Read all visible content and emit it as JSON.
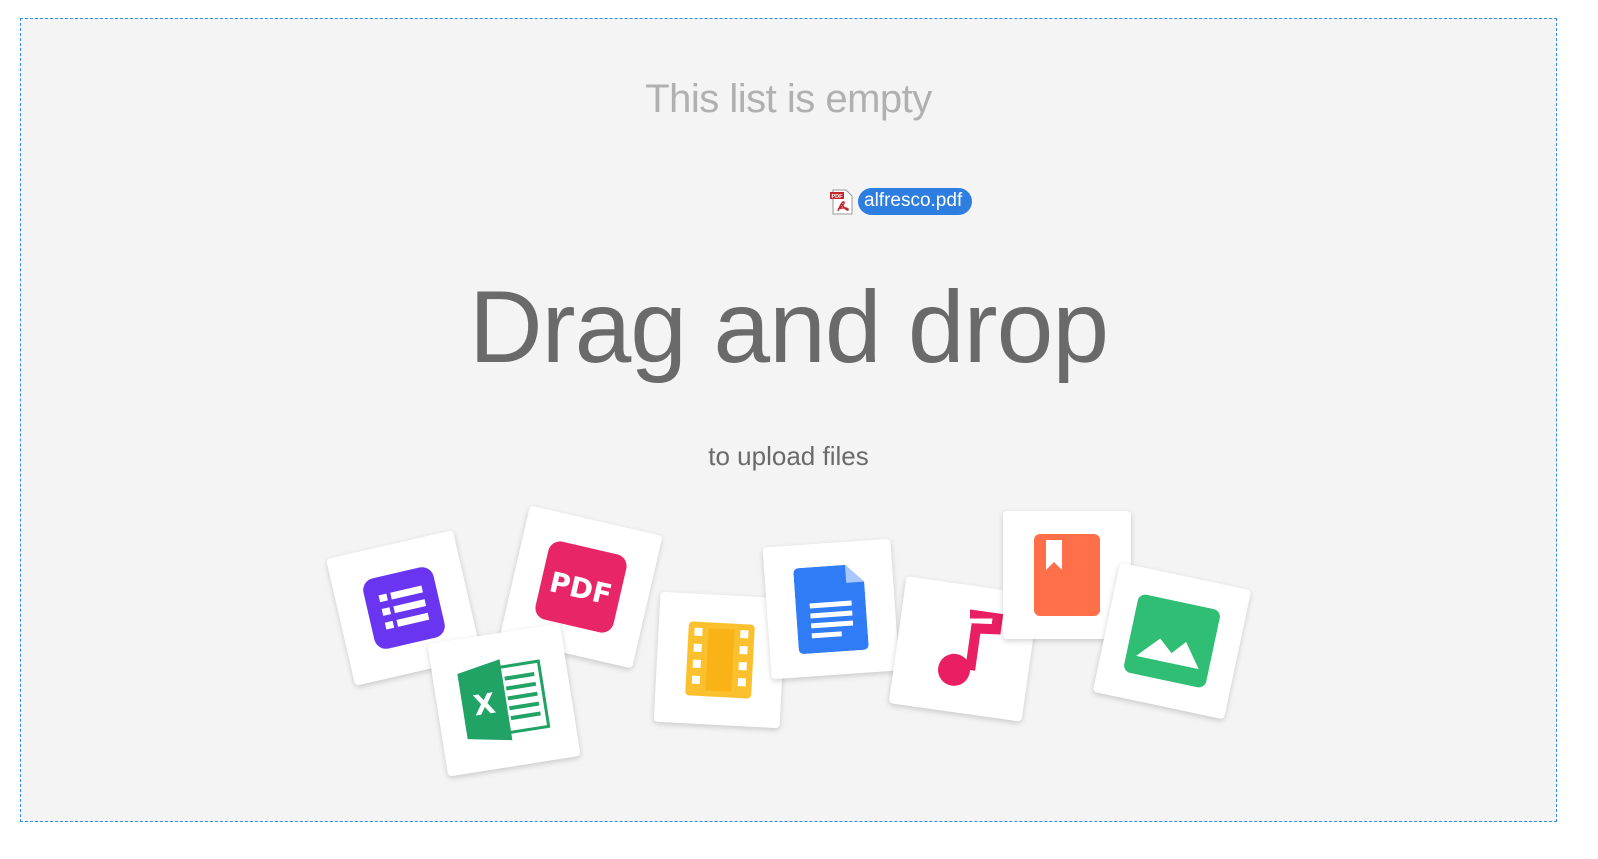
{
  "dropzone": {
    "empty_message": "This list is empty",
    "headline": "Drag and drop",
    "subtitle": "to upload files"
  },
  "dragged_file": {
    "name": "alfresco.pdf",
    "icon": "pdf-file-icon"
  },
  "file_type_cards": [
    {
      "icon": "list-document-icon",
      "color": "#6a35f0"
    },
    {
      "icon": "pdf-icon",
      "label": "PDF",
      "color": "#e82566"
    },
    {
      "icon": "excel-spreadsheet-icon",
      "label": "X",
      "color": "#21a366"
    },
    {
      "icon": "video-film-icon",
      "color": "#fbc02d"
    },
    {
      "icon": "text-document-icon",
      "color": "#2f7cf6"
    },
    {
      "icon": "music-note-icon",
      "color": "#e91e63"
    },
    {
      "icon": "ebook-bookmark-icon",
      "color": "#ff6f4a"
    },
    {
      "icon": "image-picture-icon",
      "color": "#2fbe74"
    }
  ],
  "colors": {
    "border": "#2d8ef3",
    "background": "#f4f4f4",
    "chip": "#2d7ee0"
  }
}
